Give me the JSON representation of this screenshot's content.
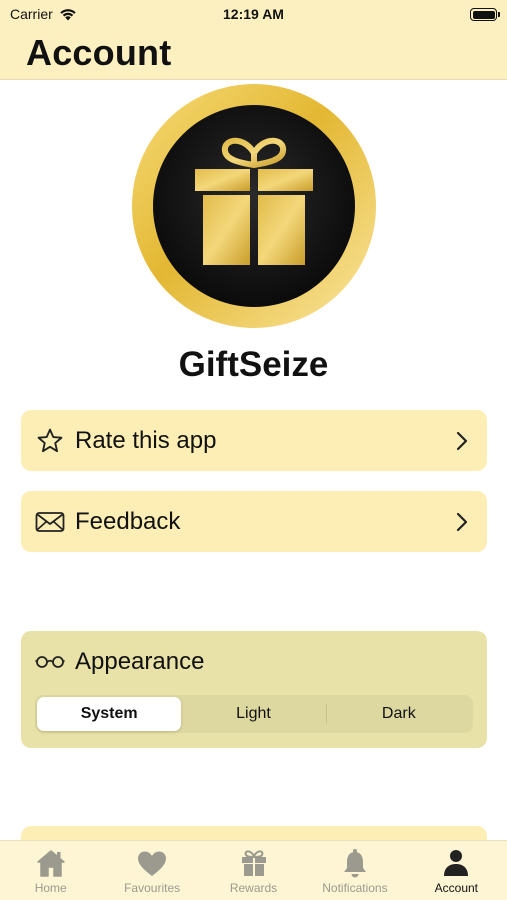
{
  "status_bar": {
    "carrier": "Carrier",
    "time": "12:19 AM"
  },
  "nav": {
    "title": "Account"
  },
  "app": {
    "name": "GiftSeize"
  },
  "menu": {
    "rate": {
      "label": "Rate this app",
      "icon": "star-icon"
    },
    "feedback": {
      "label": "Feedback",
      "icon": "envelope-icon"
    }
  },
  "appearance": {
    "title": "Appearance",
    "icon": "glasses-icon",
    "options": [
      "System",
      "Light",
      "Dark"
    ],
    "selected": "System"
  },
  "tabs": [
    {
      "label": "Home",
      "icon": "house-icon"
    },
    {
      "label": "Favourites",
      "icon": "heart-icon"
    },
    {
      "label": "Rewards",
      "icon": "gift-icon"
    },
    {
      "label": "Notifications",
      "icon": "bell-icon"
    },
    {
      "label": "Account",
      "icon": "person-icon"
    }
  ],
  "active_tab": "Account",
  "colors": {
    "header_bg": "#fdf0c0",
    "row_bg": "#fdeeb5",
    "appearance_bg": "#e8e2a8",
    "gold": "#e0b93a",
    "tab_inactive": "#9c9a8e",
    "tab_active": "#111111"
  }
}
